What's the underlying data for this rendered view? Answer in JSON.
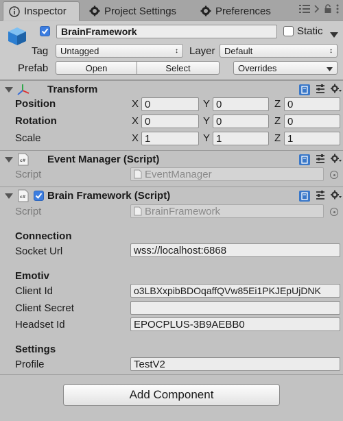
{
  "tabs": [
    {
      "label": "Inspector",
      "icon": "info-icon",
      "active": true
    },
    {
      "label": "Project Settings",
      "icon": "gear-icon",
      "active": false
    },
    {
      "label": "Preferences",
      "icon": "gear-icon",
      "active": false
    }
  ],
  "object": {
    "name": "BrainFramework",
    "active": true,
    "static_label": "Static",
    "static_checked": false,
    "tag_label": "Tag",
    "tag_value": "Untagged",
    "layer_label": "Layer",
    "layer_value": "Default",
    "prefab_label": "Prefab",
    "open_label": "Open",
    "select_label": "Select",
    "overrides_label": "Overrides"
  },
  "transform": {
    "title": "Transform",
    "rows": [
      {
        "label": "Position",
        "x": "0",
        "y": "0",
        "z": "0"
      },
      {
        "label": "Rotation",
        "x": "0",
        "y": "0",
        "z": "0"
      },
      {
        "label": "Scale",
        "x": "1",
        "y": "1",
        "z": "1"
      }
    ],
    "axis": {
      "x": "X",
      "y": "Y",
      "z": "Z"
    }
  },
  "event_manager": {
    "title": "Event Manager (Script)",
    "script_label": "Script",
    "script_value": "EventManager"
  },
  "brain_framework": {
    "title": "Brain Framework (Script)",
    "enabled": true,
    "script_label": "Script",
    "script_value": "BrainFramework",
    "connection_header": "Connection",
    "socket_url_label": "Socket Url",
    "socket_url_value": "wss://localhost:6868",
    "emotiv_header": "Emotiv",
    "client_id_label": "Client Id",
    "client_id_value": "o3LBXxpibBDOqaffQVw85Ei1PKJEpUjDNK",
    "client_secret_label": "Client Secret",
    "client_secret_value": "",
    "headset_id_label": "Headset Id",
    "headset_id_value": "EPOCPLUS-3B9AEBB0",
    "settings_header": "Settings",
    "profile_label": "Profile",
    "profile_value": "TestV2"
  },
  "add_component_label": "Add Component",
  "colors": {
    "accent": "#3c7de0",
    "panel": "#c2c2c2",
    "tabbar": "#a5a5a5"
  }
}
